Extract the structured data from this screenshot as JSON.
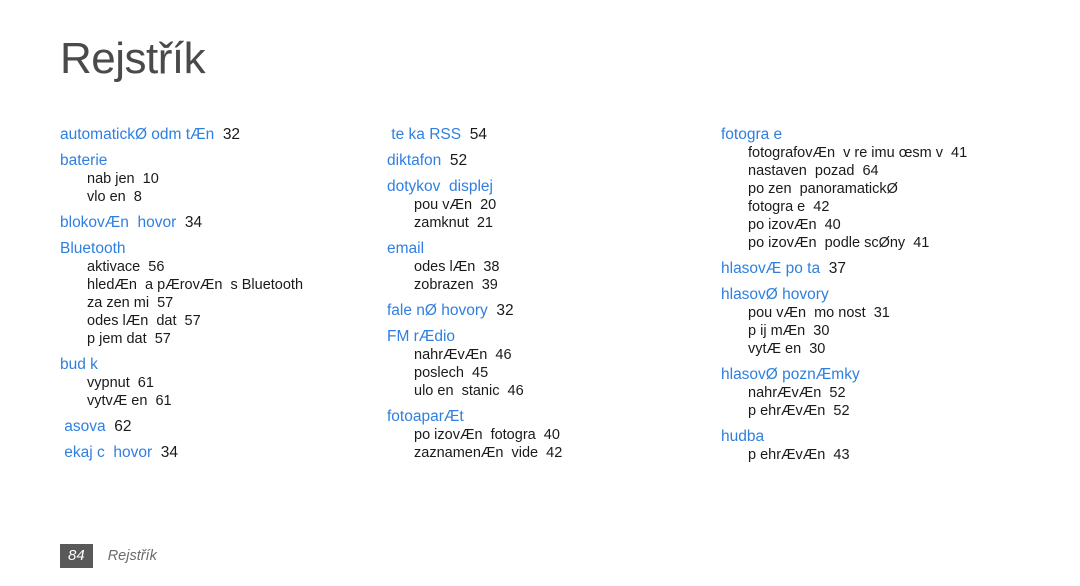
{
  "document": {
    "title": "Rejstřík",
    "accent_color": "#2f7fe0",
    "title_color": "#4a4a4a",
    "page_background": "#ffffff"
  },
  "columns": [
    {
      "groups": [
        {
          "entry": "automatickØ odm tÆn",
          "page": "32",
          "subs": []
        },
        {
          "entry": "baterie",
          "page": "",
          "subs": [
            {
              "text": "nab jen",
              "page": "10"
            },
            {
              "text": "vlo en",
              "page": "8"
            }
          ]
        },
        {
          "entry": "blokovÆn  hovor",
          "page": "34",
          "subs": []
        },
        {
          "entry": "Bluetooth",
          "page": "",
          "subs": [
            {
              "text": "aktivace",
              "page": "56"
            },
            {
              "text": "hledÆn  a pÆrovÆn  s Bluetooth",
              "page": ""
            },
            {
              "text": "za zen mi",
              "page": "57"
            },
            {
              "text": "odes lÆn  dat",
              "page": "57"
            },
            {
              "text": "p jem dat",
              "page": "57"
            }
          ]
        },
        {
          "entry": "bud k",
          "page": "",
          "subs": [
            {
              "text": "vypnut",
              "page": "61"
            },
            {
              "text": "vytvÆ en",
              "page": "61"
            }
          ]
        },
        {
          "entry": " asova",
          "page": "62",
          "subs": []
        },
        {
          "entry": " ekaj c  hovor",
          "page": "34",
          "subs": []
        }
      ]
    },
    {
      "groups": [
        {
          "entry": " te ka RSS",
          "page": "54",
          "subs": []
        },
        {
          "entry": "diktafon",
          "page": "52",
          "subs": []
        },
        {
          "entry": "dotykov  displej",
          "page": "",
          "subs": [
            {
              "text": "pou vÆn",
              "page": "20"
            },
            {
              "text": "zamknut",
              "page": "21"
            }
          ]
        },
        {
          "entry": "email",
          "page": "",
          "subs": [
            {
              "text": "odes lÆn",
              "page": "38"
            },
            {
              "text": "zobrazen",
              "page": "39"
            }
          ]
        },
        {
          "entry": "fale nØ hovory",
          "page": "32",
          "subs": []
        },
        {
          "entry": "FM rÆdio",
          "page": "",
          "subs": [
            {
              "text": "nahrÆvÆn",
              "page": "46"
            },
            {
              "text": "poslech",
              "page": "45"
            },
            {
              "text": "ulo en  stanic",
              "page": "46"
            }
          ]
        },
        {
          "entry": "fotoaparÆt",
          "page": "",
          "subs": [
            {
              "text": "po izovÆn  fotogra",
              "page": "40"
            },
            {
              "text": "zaznamenÆn  vide",
              "page": "42"
            }
          ]
        }
      ]
    },
    {
      "groups": [
        {
          "entry": "fotogra e",
          "page": "",
          "subs": [
            {
              "text": "fotografovÆn  v re imu œsm v",
              "page": "41"
            },
            {
              "text": "nastaven  pozad",
              "page": "64"
            },
            {
              "text": "po zen  panoramatickØ",
              "page": ""
            },
            {
              "text": "fotogra e",
              "page": "42"
            },
            {
              "text": "po izovÆn",
              "page": "40"
            },
            {
              "text": "po izovÆn  podle scØny",
              "page": "41"
            }
          ]
        },
        {
          "entry": "hlasovÆ po ta",
          "page": "37",
          "subs": []
        },
        {
          "entry": "hlasovØ hovory",
          "page": "",
          "subs": [
            {
              "text": "pou vÆn  mo nost",
              "page": "31"
            },
            {
              "text": "p ij mÆn",
              "page": "30"
            },
            {
              "text": "vytÆ en",
              "page": "30"
            }
          ]
        },
        {
          "entry": "hlasovØ poznÆmky",
          "page": "",
          "subs": [
            {
              "text": "nahrÆvÆn",
              "page": "52"
            },
            {
              "text": "p ehrÆvÆn",
              "page": "52"
            }
          ]
        },
        {
          "entry": "hudba",
          "page": "",
          "subs": [
            {
              "text": "p ehrÆvÆn",
              "page": "43"
            }
          ]
        }
      ]
    }
  ],
  "footer": {
    "page_number": "84",
    "section_label": "Rejstřík"
  }
}
